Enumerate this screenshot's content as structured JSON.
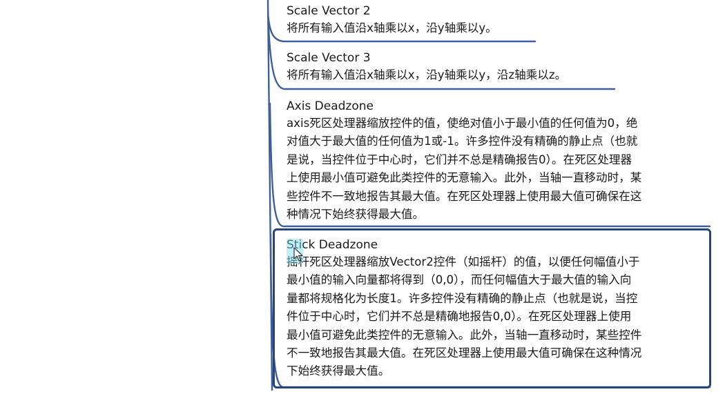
{
  "mindmap": {
    "branch_color": "#3e5f99",
    "selection_color": "#26457a",
    "nodes": [
      {
        "title": "Scale Vector 2",
        "lines": [
          "将所有输入值沿x轴乘以x，沿y轴乘以y。"
        ]
      },
      {
        "title": "Scale Vector 3",
        "lines": [
          "将所有输入值沿x轴乘以x，沿y轴乘以y，沿z轴乘以z。"
        ]
      },
      {
        "title": "Axis Deadzone",
        "lines": [
          "axis死区处理器缩放控件的值，使绝对值小于最小值的任何值为0，绝",
          "对值大于最大值的任何值为1或-1。许多控件没有精确的静止点（也就",
          "是说，当控件位于中心时，它们并不总是精确报告0）。在死区处理器",
          "上使用最小值可避免此类控件的无意输入。此外，当轴一直移动时，某",
          "些控件不一致地报告其最大值。在死区处理器上使用最大值可确保在这",
          "种情况下始终获得最大值。"
        ]
      },
      {
        "title": "Stick Deadzone",
        "selected": true,
        "lines": [
          "摇杆死区处理器缩放Vector2控件（如摇杆）的值，以便任何幅值小于",
          "最小值的输入向量都将得到（0,0），而任何幅值大于最大值的输入向",
          "量都将规格化为长度1。许多控件没有精确的静止点（也就是说，当控",
          "件位于中心时，它们并不总是精确地报告0,0）。在死区处理器上使用",
          "最小值可避免此类控件的无意输入。此外，当轴一直移动时，某些控件",
          "不一致地报告其最大值。在死区处理器上使用最大值可确保在这种情况",
          "下始终获得最大值。"
        ]
      }
    ]
  }
}
